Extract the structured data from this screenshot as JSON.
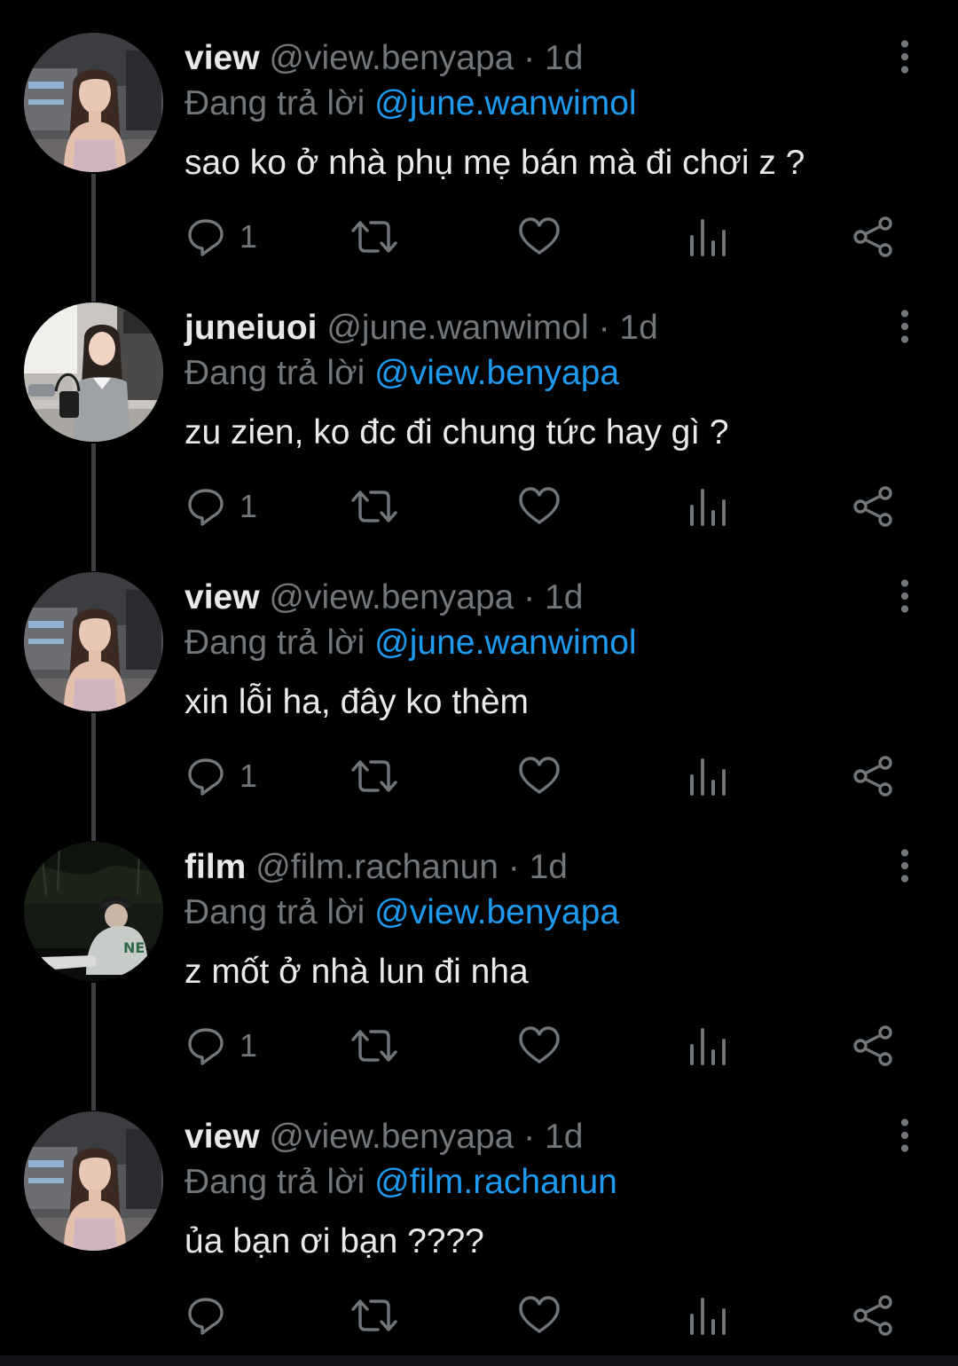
{
  "colors": {
    "background": "#000000",
    "primary_text": "#e7e9ea",
    "secondary_text": "#71767b",
    "mention": "#1d9bf0",
    "thread_line": "#3e4144"
  },
  "icons": {
    "reply": "reply-icon",
    "retweet": "retweet-icon",
    "like": "heart-icon",
    "views": "views-icon",
    "share": "share-icon",
    "more": "more-vertical-icon"
  },
  "tweets": [
    {
      "name": "view",
      "handle": "@view.benyapa",
      "dot": "·",
      "time": "1d",
      "reply_prefix": "Đang trả lời",
      "reply_to": "@june.wanwimol",
      "text": "sao ko ở nhà phụ mẹ bán mà đi chơi z ?",
      "reply_count": "1"
    },
    {
      "name": "juneiuoi",
      "handle": "@june.wanwimol",
      "dot": "·",
      "time": "1d",
      "reply_prefix": "Đang trả lời",
      "reply_to": "@view.benyapa",
      "text": "zu zien, ko đc đi chung tức hay gì ?",
      "reply_count": "1"
    },
    {
      "name": "view",
      "handle": "@view.benyapa",
      "dot": "·",
      "time": "1d",
      "reply_prefix": "Đang trả lời",
      "reply_to": "@june.wanwimol",
      "text": "xin lỗi ha, đây ko thèm",
      "reply_count": "1"
    },
    {
      "name": "film",
      "handle": "@film.rachanun",
      "dot": "·",
      "time": "1d",
      "reply_prefix": "Đang trả lời",
      "reply_to": "@view.benyapa",
      "text": "z mốt ở nhà lun đi nha",
      "reply_count": "1"
    },
    {
      "name": "view",
      "handle": "@view.benyapa",
      "dot": "·",
      "time": "1d",
      "reply_prefix": "Đang trả lời",
      "reply_to": "@film.rachanun",
      "text": "ủa bạn ơi bạn ????",
      "reply_count": ""
    }
  ]
}
